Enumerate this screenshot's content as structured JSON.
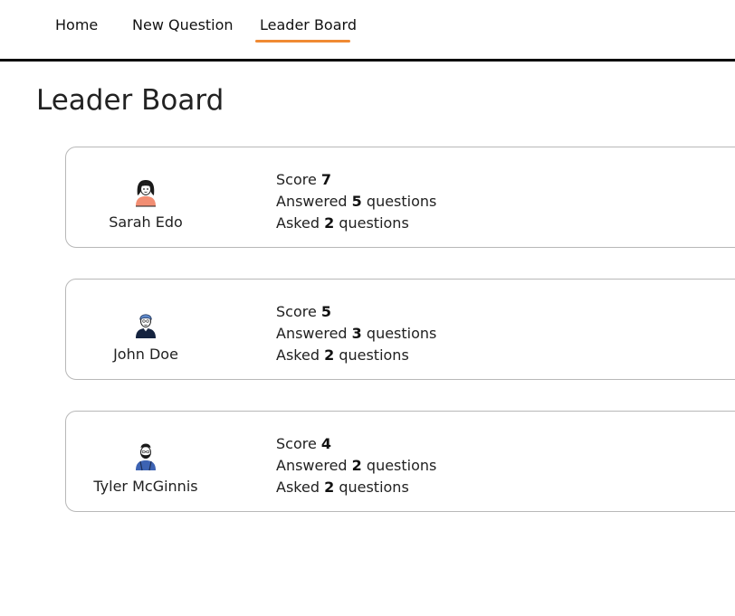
{
  "nav": {
    "items": [
      {
        "label": "Home"
      },
      {
        "label": "New Question"
      },
      {
        "label": "Leader Board"
      }
    ],
    "active_index": 2,
    "accent_color": "#f08a33"
  },
  "page": {
    "title": "Leader Board"
  },
  "leaderboard": [
    {
      "name": "Sarah Edo",
      "avatar_icon": "woman-avatar-icon",
      "score_label": "Score",
      "score": "7",
      "answered_label": "Answered",
      "answered": "5",
      "answered_suffix": "questions",
      "asked_label": "Asked",
      "asked": "2",
      "asked_suffix": "questions"
    },
    {
      "name": "John Doe",
      "avatar_icon": "man-avatar-icon",
      "score_label": "Score",
      "score": "5",
      "answered_label": "Answered",
      "answered": "3",
      "answered_suffix": "questions",
      "asked_label": "Asked",
      "asked": "2",
      "asked_suffix": "questions"
    },
    {
      "name": "Tyler McGinnis",
      "avatar_icon": "bearded-man-avatar-icon",
      "score_label": "Score",
      "score": "4",
      "answered_label": "Answered",
      "answered": "2",
      "answered_suffix": "questions",
      "asked_label": "Asked",
      "asked": "2",
      "asked_suffix": "questions"
    }
  ]
}
